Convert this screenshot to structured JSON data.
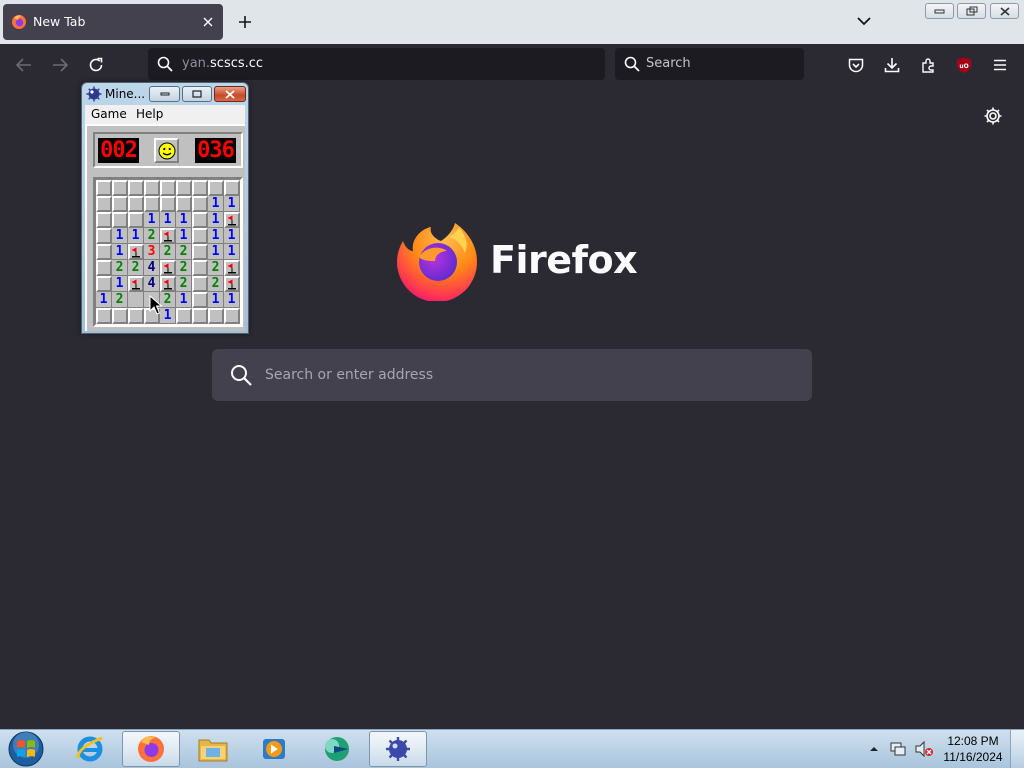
{
  "browser": {
    "tab": {
      "title": "New Tab",
      "icon": "firefox-icon"
    },
    "url_value_prefix": "yan.",
    "url_value_domain": "scscs.cc",
    "search_placeholder": "Search",
    "wordmark": "Firefox",
    "newtab_search_placeholder": "Search or enter address",
    "colors": {
      "accent": "#e66000",
      "content_bg": "#2b2a33"
    }
  },
  "minesweeper": {
    "title": "Mine...",
    "menu": [
      "Game",
      "Help"
    ],
    "mines_left": "002",
    "timer": "036",
    "face": "smiley",
    "rows": [
      [
        "r",
        "r",
        "r",
        "r",
        "r",
        "r",
        "r",
        "r",
        "r"
      ],
      [
        "r",
        "r",
        "r",
        "r",
        "r",
        "r",
        "r",
        "1",
        "1"
      ],
      [
        "r",
        "r",
        "r",
        "1",
        "1",
        "1",
        "r",
        "1",
        "F"
      ],
      [
        "r",
        "1",
        "1",
        "2",
        "F",
        "1",
        "r",
        "1",
        "1"
      ],
      [
        "r",
        "1",
        "F",
        "3",
        "2",
        "2",
        "r",
        "1",
        "1"
      ],
      [
        "r",
        "2",
        "2",
        "4",
        "F",
        "2",
        "r",
        "2",
        "F"
      ],
      [
        "r",
        "1",
        "F",
        "4",
        "F",
        "2",
        "r",
        "2",
        "F"
      ],
      [
        "1",
        "2",
        "o",
        "o",
        "2",
        "1",
        "r",
        "1",
        "1"
      ],
      [
        "r",
        "r",
        "r",
        "r",
        "1",
        "r",
        "r",
        "r",
        "r"
      ]
    ]
  },
  "taskbar": {
    "clock_time": "12:08 PM",
    "clock_date": "11/16/2024",
    "items": [
      "start",
      "internet-explorer",
      "firefox",
      "windows-explorer",
      "media-player",
      "remote-assistance",
      "minesweeper"
    ]
  }
}
